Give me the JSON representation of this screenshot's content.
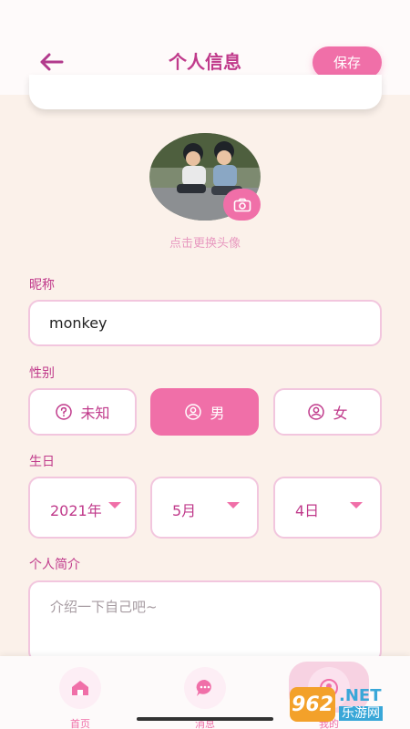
{
  "header": {
    "title": "个人信息",
    "save_label": "保存",
    "back_icon": "arrow-left-icon"
  },
  "avatar": {
    "hint": "点击更换头像",
    "camera_icon": "camera-icon"
  },
  "nickname": {
    "label": "昵称",
    "value": "monkey"
  },
  "gender": {
    "label": "性别",
    "options": [
      {
        "label": "未知",
        "icon": "question-circle-icon",
        "selected": false
      },
      {
        "label": "男",
        "icon": "user-circle-icon",
        "selected": true
      },
      {
        "label": "女",
        "icon": "user-circle-icon",
        "selected": false
      }
    ]
  },
  "birthday": {
    "label": "生日",
    "year": "2021年",
    "month": "5月",
    "day": "4日"
  },
  "bio": {
    "label": "个人简介",
    "placeholder": "介绍一下自己吧~"
  },
  "nav": {
    "items": [
      {
        "label": "首页",
        "icon": "home-icon"
      },
      {
        "label": "消息",
        "icon": "chat-bubble-icon"
      },
      {
        "label": "我的",
        "icon": "profile-icon"
      }
    ]
  },
  "watermark": {
    "badge": "962",
    "net": ".NET",
    "cn": "乐游网"
  },
  "colors": {
    "accent": "#f06fa8",
    "title": "#c03a8b",
    "border": "#f2c6de",
    "background": "#fbf1ea"
  }
}
